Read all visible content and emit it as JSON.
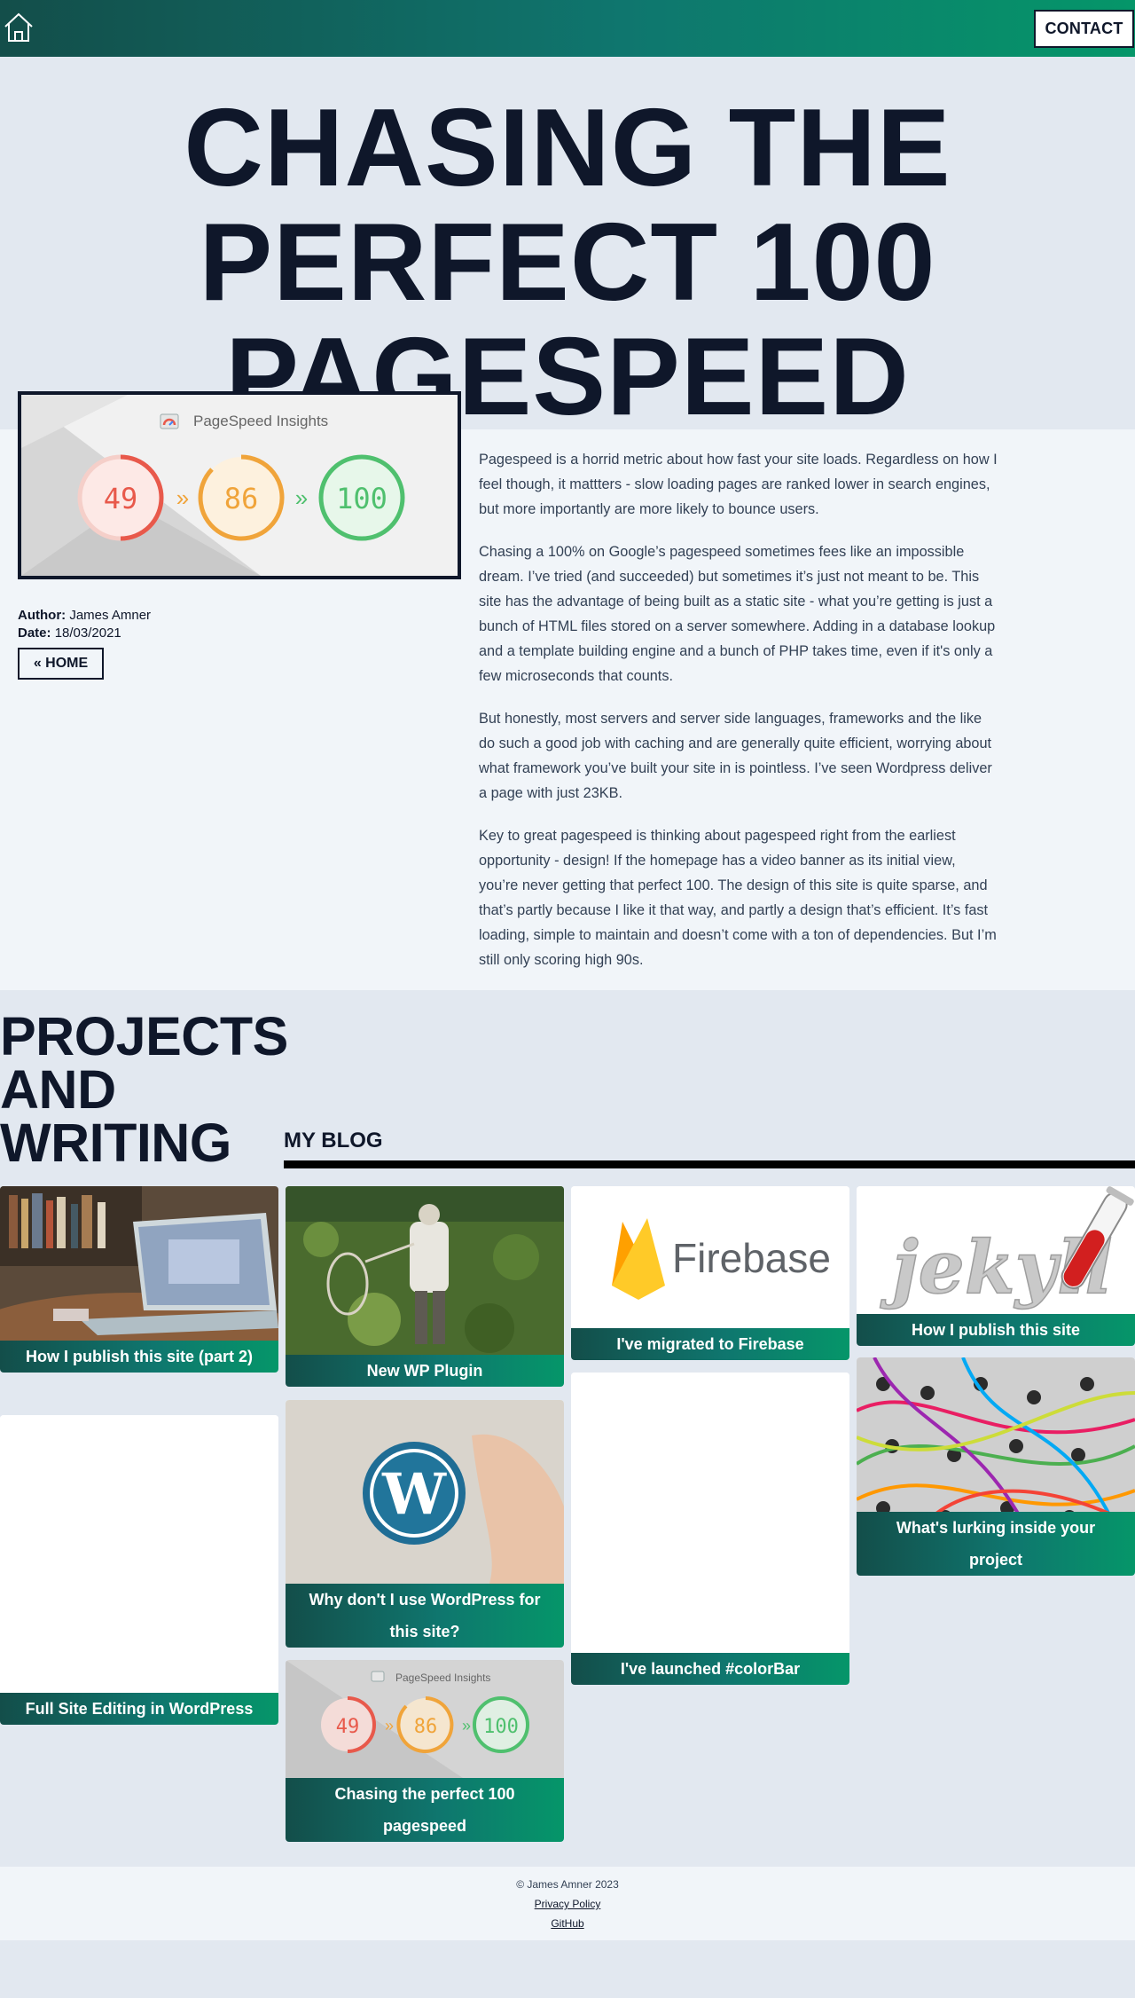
{
  "header": {
    "home_icon": "home-icon",
    "contact_label": "CONTACT"
  },
  "hero": {
    "title_line1": "CHASING THE",
    "title_line2": "PERFECT 100",
    "title_line3": "PAGESPEED"
  },
  "feature": {
    "brand": "PageSpeed Insights",
    "scores": [
      "49",
      "86",
      "100"
    ],
    "score_colors": [
      "#e8594b",
      "#f0a43a",
      "#4fc06e"
    ]
  },
  "meta": {
    "author_label": "Author:",
    "author": "James Amner",
    "date_label": "Date:",
    "date": "18/03/2021",
    "back_label": "« HOME"
  },
  "article": {
    "paragraphs": [
      "Pagespeed is a horrid metric about how fast your site loads. Regardless on how I feel though, it mattters - slow loading pages are ranked lower in search engines, but more importantly are more likely to bounce users.",
      "Chasing a 100% on Google’s pagespeed sometimes fees like an impossible dream. I’ve tried (and succeeded) but sometimes it’s just not meant to be. This site has the advantage of being built as a static site - what you’re getting is just a bunch of HTML files stored on a server somewhere. Adding in a database lookup and a template building engine and a bunch of PHP takes time, even if it's only a few microseconds that counts.",
      "But honestly, most servers and server side languages, frameworks and the like do such a good job with caching and are generally quite efficient, worrying about what framework you’ve built your site in is pointless. I’ve seen Wordpress deliver a page with just 23KB.",
      "Key to great pagespeed is thinking about pagespeed right from the earliest opportunity - design! If the homepage has a video banner as its initial view, you’re never getting that perfect 100. The design of this site is quite sparse, and that’s partly because I like it that way, and partly a design that’s efficient. It’s fast loading, simple to maintain and doesn’t come with a ton of dependencies. But I’m still only scoring high 90s."
    ]
  },
  "projects": {
    "heading_line1": "PROJECTS",
    "heading_line2": "AND",
    "heading_line3": "WRITING",
    "blog_title": "MY BLOG",
    "cards": [
      {
        "title": "How I publish this site (part 2)"
      },
      {
        "title": "Full Site Editing in WordPress"
      },
      {
        "title": "New WP Plugin"
      },
      {
        "title": "Why don't I use WordPress for this site?"
      },
      {
        "title": "Chasing the perfect 100 pagespeed",
        "brand": "PageSpeed Insights",
        "scores": [
          "49",
          "86",
          "100"
        ]
      },
      {
        "title": "I've migrated to Firebase",
        "logo_text": "Firebase"
      },
      {
        "title": "I've launched #colorBar"
      },
      {
        "title": "How I publish this site",
        "logo_text": "jekyll"
      },
      {
        "title": "What's lurking inside your project"
      }
    ]
  },
  "footer": {
    "copyright": "© James Amner 2023",
    "privacy": "Privacy Policy",
    "github": "GitHub"
  }
}
